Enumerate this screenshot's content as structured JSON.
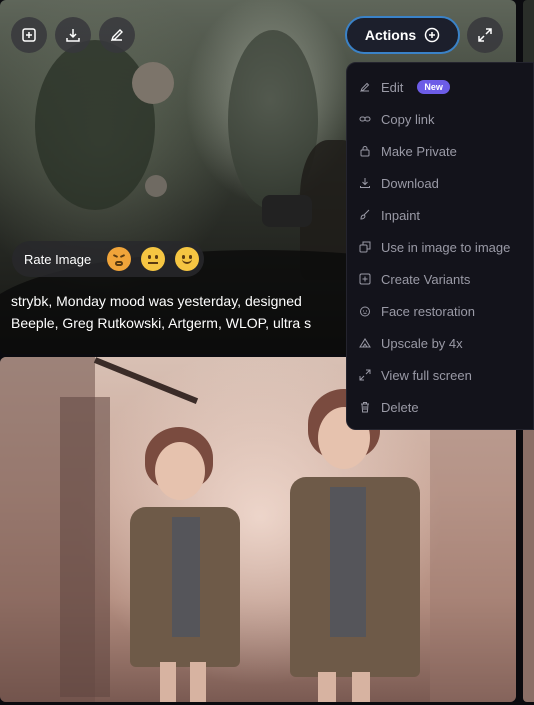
{
  "toolbar": {
    "buttons": [
      {
        "icon": "add-square-icon"
      },
      {
        "icon": "download-icon"
      },
      {
        "icon": "pencil-icon"
      }
    ],
    "actions_label": "Actions",
    "actions_icon": "plus-circle-icon",
    "expand_icon": "expand-arrows-icon"
  },
  "rating": {
    "label": "Rate Image",
    "emojis": [
      "tired-face",
      "neutral-face",
      "slightly-smiling-face"
    ]
  },
  "caption": {
    "line1": "strybk, Monday mood was yesterday, designed",
    "line2": "Beeple, Greg Rutkowski, Artgerm, WLOP, ultra s"
  },
  "menu": {
    "items": [
      {
        "label": "Edit",
        "icon": "pencil-icon",
        "badge": "New"
      },
      {
        "label": "Copy link",
        "icon": "link-icon"
      },
      {
        "label": "Make Private",
        "icon": "lock-icon"
      },
      {
        "label": "Download",
        "icon": "download-icon"
      },
      {
        "label": "Inpaint",
        "icon": "brush-icon"
      },
      {
        "label": "Use in image to image",
        "icon": "copy-icon"
      },
      {
        "label": "Create Variants",
        "icon": "plus-square-icon"
      },
      {
        "label": "Face restoration",
        "icon": "face-icon"
      },
      {
        "label": "Upscale by 4x",
        "icon": "upscale-icon"
      },
      {
        "label": "View full screen",
        "icon": "expand-icon"
      },
      {
        "label": "Delete",
        "icon": "trash-icon"
      }
    ]
  },
  "colors": {
    "menu_bg": "#13131b",
    "accent_border": "#3a82c8",
    "badge": "#6c5ce7",
    "menu_text": "#9a9aa6"
  }
}
